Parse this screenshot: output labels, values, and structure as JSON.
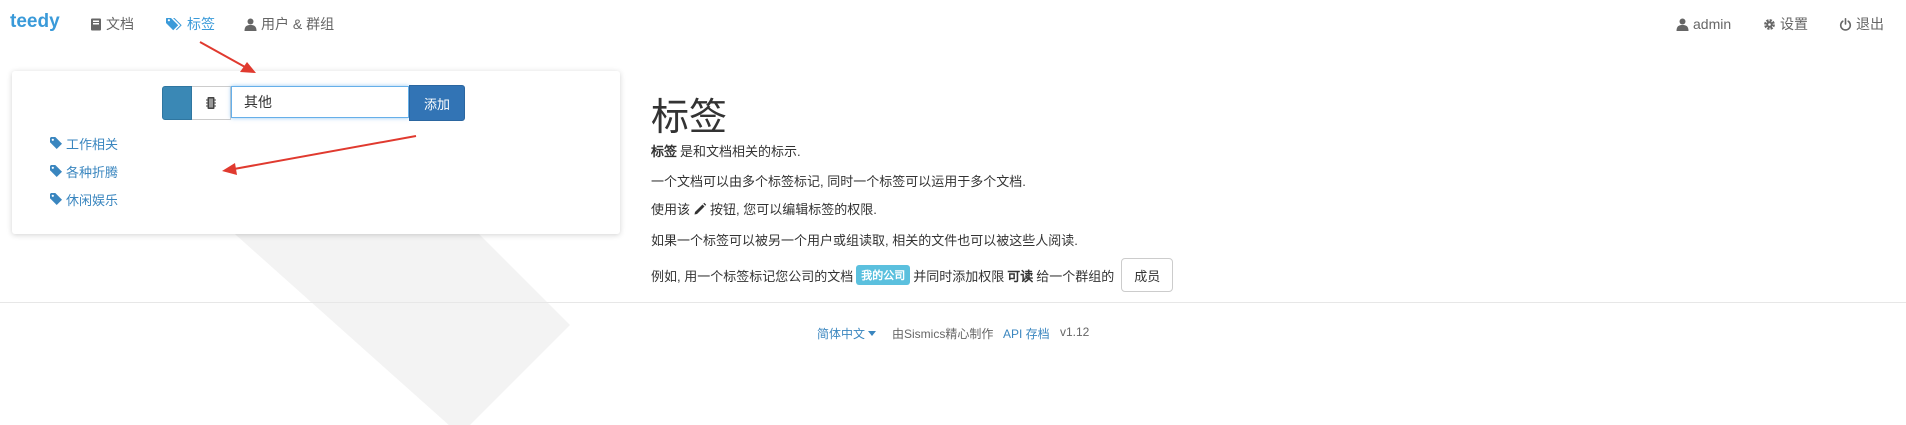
{
  "navbar": {
    "brand": "teedy",
    "items": [
      {
        "label": "文档",
        "icon": "book-icon"
      },
      {
        "label": "标签",
        "icon": "tags-icon",
        "active": true
      },
      {
        "label": "用户 & 群组",
        "icon": "user-icon"
      }
    ],
    "right_items": [
      {
        "label": "admin",
        "icon": "user-icon"
      },
      {
        "label": "设置",
        "icon": "gear-icon"
      },
      {
        "label": "退出",
        "icon": "power-icon"
      }
    ]
  },
  "tag_panel": {
    "input_value": "其他",
    "add_label": "添加",
    "tags": [
      "工作相关",
      "各种折腾",
      "休闲娱乐"
    ]
  },
  "help": {
    "title": "标签",
    "line1_bold": "标签",
    "line1_rest": "是和文档相关的标示.",
    "line2": "一个文档可以由多个标签标记, 同时一个标签可以运用于多个文档.",
    "line3_pre": "使用该",
    "line3_post": "按钮, 您可以编辑标签的权限.",
    "line4": "如果一个标签可以被另一个用户或组读取, 相关的文件也可以被这些人阅读.",
    "line5_pre": "例如, 用一个标签标记您公司的文档",
    "line5_badge": "我的公司",
    "line5_mid": "并同时添加权限",
    "line5_bold": "可读",
    "line5_post": "给一个群组的",
    "member_button": "成员"
  },
  "footer": {
    "language": "简体中文",
    "made_by": "由Sismics精心制作",
    "api": "API 存档",
    "version": "v1.12"
  },
  "colors": {
    "accent": "#3a9ad9",
    "primary_button": "#3274b5",
    "tag_color": "#3a88b5",
    "badge": "#5bc0de",
    "annotation_arrow": "#e03a2f"
  }
}
